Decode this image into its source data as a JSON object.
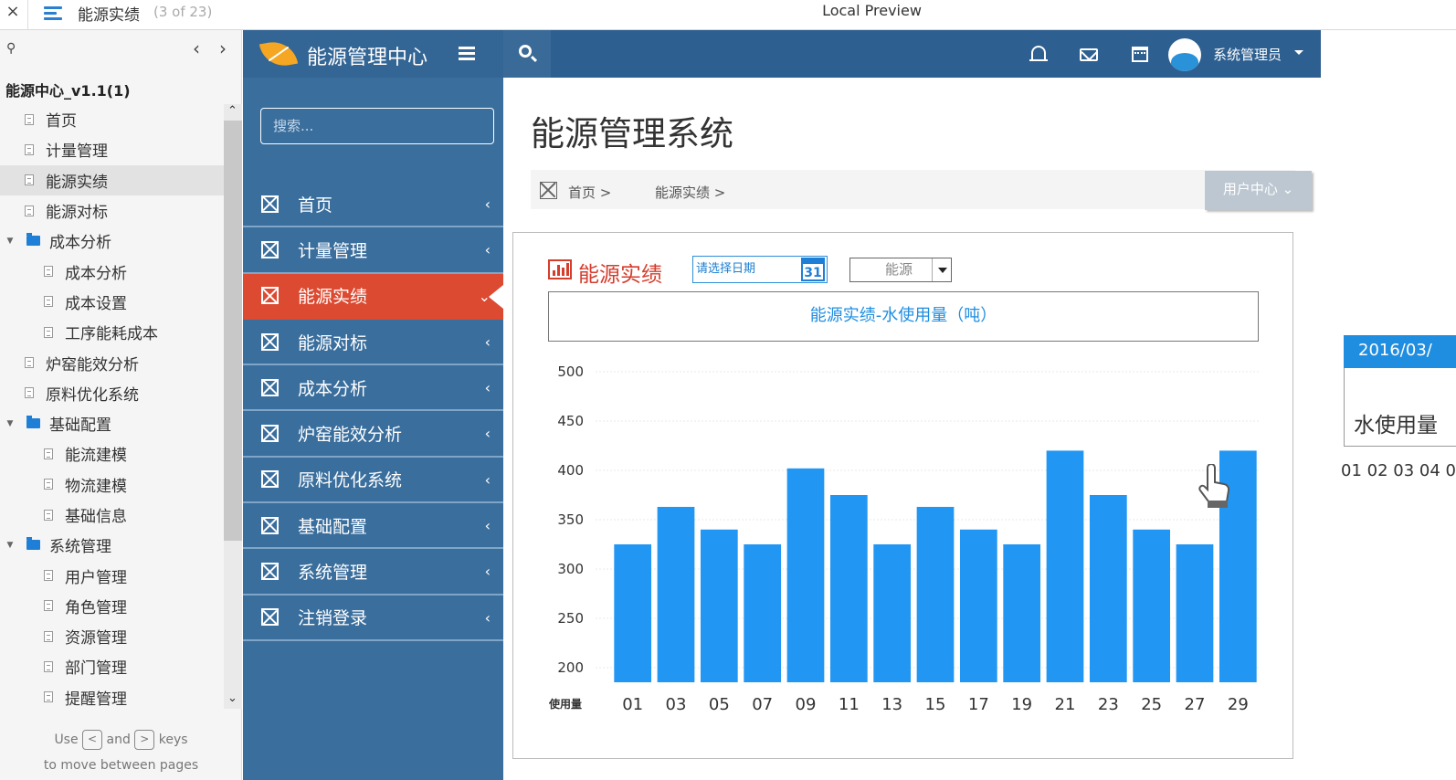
{
  "topbar": {
    "close_glyph": "×",
    "doc_title": "能源实绩",
    "doc_count": "(3 of 23)",
    "center_title": "Local Preview"
  },
  "outline": {
    "root": "能源中心_v1.1(1)",
    "items": [
      {
        "label": "首页",
        "type": "page",
        "level": 0
      },
      {
        "label": "计量管理",
        "type": "page",
        "level": 0
      },
      {
        "label": "能源实绩",
        "type": "page",
        "level": 0,
        "active": true
      },
      {
        "label": "能源对标",
        "type": "page",
        "level": 0
      },
      {
        "label": "成本分析",
        "type": "folder",
        "level": 0
      },
      {
        "label": "成本分析",
        "type": "page",
        "level": 1
      },
      {
        "label": "成本设置",
        "type": "page",
        "level": 1
      },
      {
        "label": "工序能耗成本",
        "type": "page",
        "level": 1
      },
      {
        "label": "炉窑能效分析",
        "type": "page",
        "level": 0
      },
      {
        "label": "原料优化系统",
        "type": "page",
        "level": 0
      },
      {
        "label": "基础配置",
        "type": "folder",
        "level": 0
      },
      {
        "label": "能流建模",
        "type": "page",
        "level": 1
      },
      {
        "label": "物流建模",
        "type": "page",
        "level": 1
      },
      {
        "label": "基础信息",
        "type": "page",
        "level": 1
      },
      {
        "label": "系统管理",
        "type": "folder",
        "level": 0
      },
      {
        "label": "用户管理",
        "type": "page",
        "level": 1
      },
      {
        "label": "角色管理",
        "type": "page",
        "level": 1
      },
      {
        "label": "资源管理",
        "type": "page",
        "level": 1
      },
      {
        "label": "部门管理",
        "type": "page",
        "level": 1
      },
      {
        "label": "提醒管理",
        "type": "page",
        "level": 1
      }
    ],
    "hint_use": "Use",
    "hint_and": "and",
    "hint_keys": "keys",
    "hint_line2": "to move between pages",
    "key_prev": "<",
    "key_next": ">"
  },
  "app": {
    "name": "能源管理中心",
    "user": "系统管理员",
    "search_placeholder": "搜索...",
    "nav": [
      {
        "label": "首页",
        "active": false
      },
      {
        "label": "计量管理",
        "active": false
      },
      {
        "label": "能源实绩",
        "active": true
      },
      {
        "label": "能源对标",
        "active": false
      },
      {
        "label": "成本分析",
        "active": false
      },
      {
        "label": "炉窑能效分析",
        "active": false
      },
      {
        "label": "原料优化系统",
        "active": false
      },
      {
        "label": "基础配置",
        "active": false
      },
      {
        "label": "系统管理",
        "active": false
      },
      {
        "label": "注销登录",
        "active": false
      }
    ],
    "colors": {
      "nav": "#3a6e9d",
      "header": "#2d5f90",
      "active": "#dc4a31",
      "bar": "#2196f3",
      "accent": "#d53d2d"
    }
  },
  "main": {
    "title": "能源管理系统",
    "breadcrumb": [
      "首页 >",
      "能源实绩 >"
    ],
    "user_center": "用户中心 ⌄",
    "panel_title": "能源实绩",
    "date_placeholder": "请选择日期",
    "calendar_day": "31",
    "select_value": "能源"
  },
  "chart_data": {
    "type": "bar",
    "title": "能源实绩-水使用量（吨）",
    "xlabel": "使用量",
    "ylim": [
      200,
      500
    ],
    "yticks": [
      500,
      450,
      400,
      350,
      300,
      250,
      200
    ],
    "categories": [
      "01",
      "03",
      "05",
      "07",
      "09",
      "11",
      "13",
      "15",
      "17",
      "19",
      "21",
      "23",
      "25",
      "27",
      "29"
    ],
    "values": [
      325,
      363,
      340,
      325,
      402,
      375,
      325,
      363,
      340,
      325,
      420,
      375,
      340,
      325,
      420
    ],
    "grid": true
  },
  "right_card": {
    "header": "2016/03/",
    "title": "水使用量",
    "numbers": "01 02 03 04 0"
  }
}
